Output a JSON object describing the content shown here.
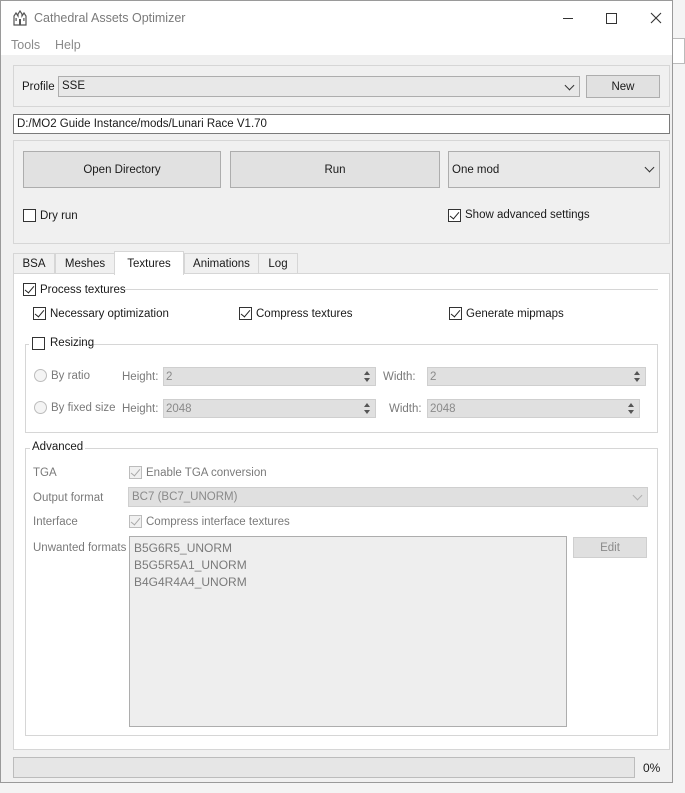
{
  "window": {
    "title": "Cathedral Assets Optimizer",
    "controls": {
      "minimize": "minimize-icon",
      "maximize": "maximize-icon",
      "close": "close-icon"
    }
  },
  "menu": {
    "items": [
      "Tools",
      "Help"
    ]
  },
  "profile": {
    "label": "Profile",
    "value": "SSE",
    "new_button": "New"
  },
  "path": {
    "value": "D:/MO2 Guide Instance/mods/Lunari Race V1.70"
  },
  "actions": {
    "open_directory": "Open Directory",
    "run": "Run",
    "mode": "One mod",
    "dry_run": {
      "label": "Dry run",
      "checked": false
    },
    "show_advanced": {
      "label": "Show advanced settings",
      "checked": true
    }
  },
  "tabs": [
    {
      "label": "BSA",
      "active": false
    },
    {
      "label": "Meshes",
      "active": false
    },
    {
      "label": "Textures",
      "active": true
    },
    {
      "label": "Animations",
      "active": false
    },
    {
      "label": "Log",
      "active": false
    }
  ],
  "textures": {
    "process": {
      "label": "Process textures",
      "checked": true
    },
    "necessary": {
      "label": "Necessary optimization",
      "checked": true
    },
    "compress": {
      "label": "Compress textures",
      "checked": true
    },
    "mipmaps": {
      "label": "Generate mipmaps",
      "checked": true
    },
    "resizing": {
      "label": "Resizing",
      "checked": false,
      "by_ratio": {
        "label": "By ratio",
        "height_label": "Height:",
        "height": "2",
        "width_label": "Width:",
        "width": "2"
      },
      "by_fixed": {
        "label": "By fixed size",
        "height_label": "Height:",
        "height": "2048",
        "width_label": "Width:",
        "width": "2048"
      }
    },
    "advanced": {
      "title": "Advanced",
      "tga_label": "TGA",
      "tga_option": {
        "label": "Enable TGA conversion",
        "checked": true
      },
      "output_label": "Output format",
      "output_value": "BC7 (BC7_UNORM)",
      "interface_label": "Interface",
      "interface_option": {
        "label": "Compress interface textures",
        "checked": true
      },
      "unwanted_label": "Unwanted formats",
      "unwanted": [
        "B5G6R5_UNORM",
        "B5G5R5A1_UNORM",
        "B4G4R4A4_UNORM"
      ],
      "edit_button": "Edit"
    }
  },
  "progress": {
    "value": 0,
    "text": "0%",
    "color": "#06b025"
  },
  "colors": {
    "window_bg": "#f0f0f0",
    "panel_bg": "#ffffff",
    "title_text": "#7a7a7a"
  }
}
